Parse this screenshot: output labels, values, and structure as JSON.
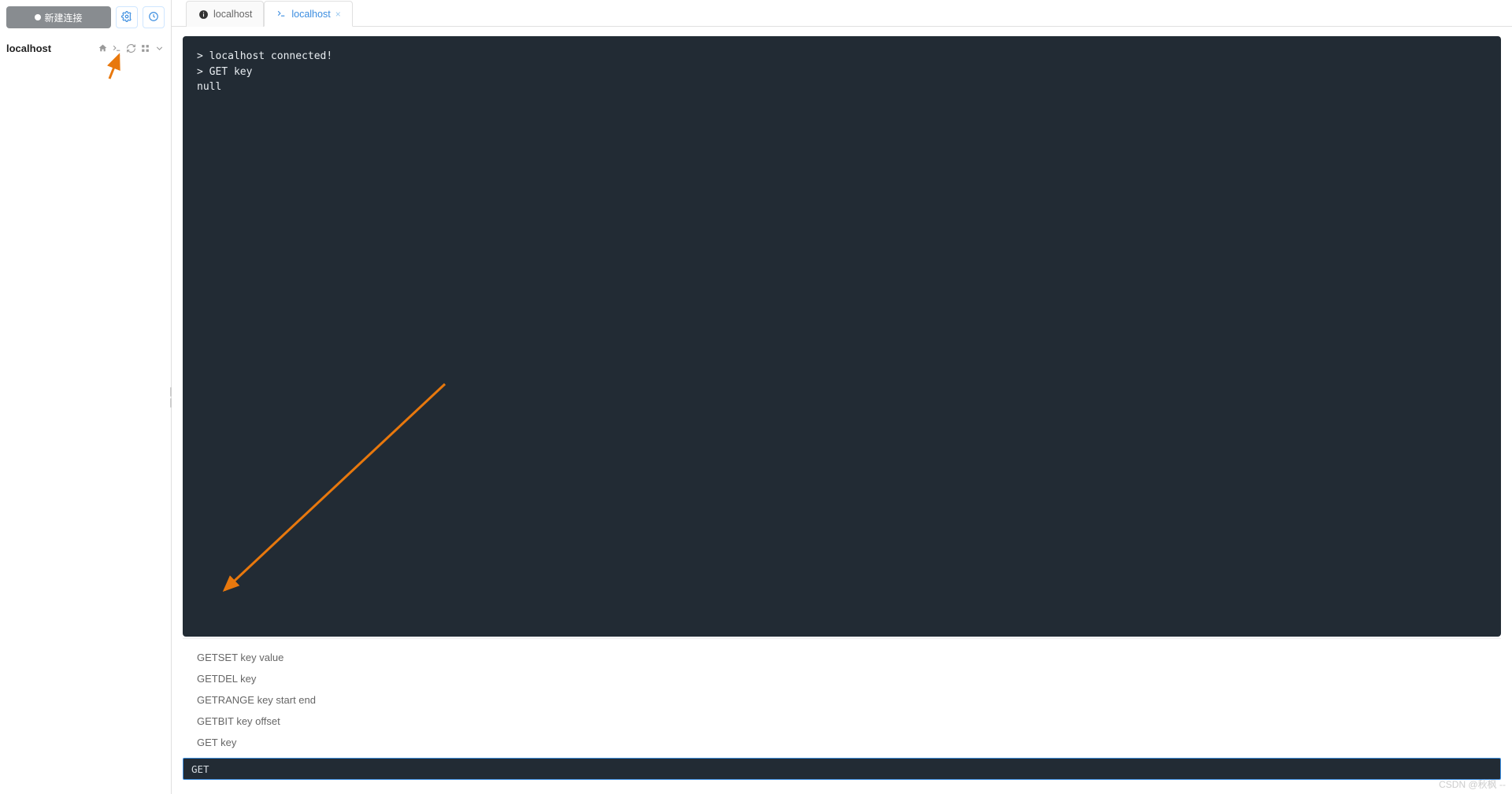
{
  "sidebar": {
    "new_connection_label": "新建连接",
    "connection_name": "localhost"
  },
  "tabs": [
    {
      "label": "localhost",
      "type": "info",
      "active": false,
      "prefix_icon": "info"
    },
    {
      "label": "localhost",
      "type": "terminal",
      "active": true,
      "prefix_icon": "terminal"
    }
  ],
  "terminal_lines": [
    "> localhost connected!",
    "> GET key",
    "null"
  ],
  "autocomplete": [
    "GETSET key value",
    "GETDEL key",
    "GETRANGE key start end",
    "GETBIT key offset",
    "GET key"
  ],
  "command_input_value": "GET",
  "watermark": "CSDN @秋枫 --"
}
